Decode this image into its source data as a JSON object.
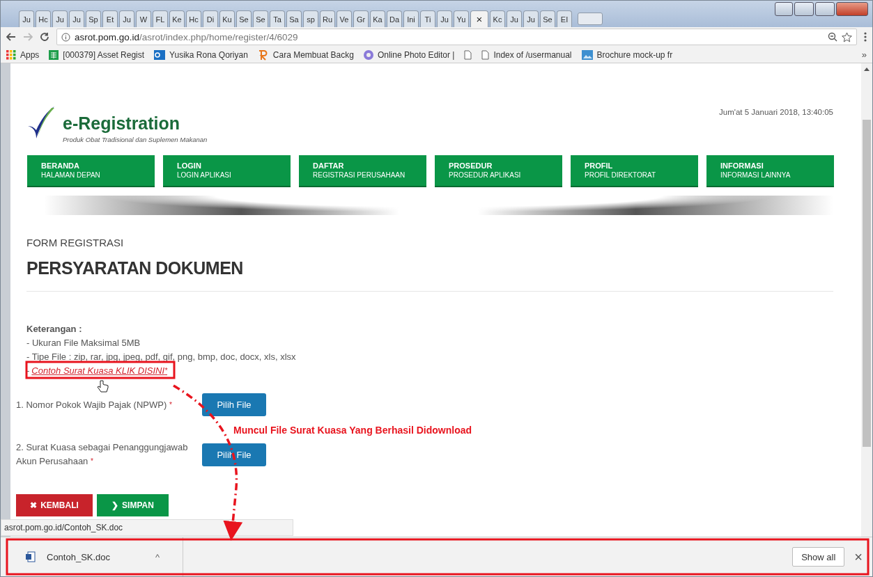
{
  "browser": {
    "tabs": [
      {
        "label": "Ju",
        "selected": false
      },
      {
        "label": "Hc",
        "selected": false
      },
      {
        "label": "Ju",
        "selected": false
      },
      {
        "label": "Ju",
        "selected": false
      },
      {
        "label": "Sp",
        "selected": false
      },
      {
        "label": "Et",
        "selected": false
      },
      {
        "label": "Ju",
        "selected": false
      },
      {
        "label": "W",
        "selected": false
      },
      {
        "label": "FL",
        "selected": false
      },
      {
        "label": "Ke",
        "selected": false
      },
      {
        "label": "Hc",
        "selected": false
      },
      {
        "label": "Di",
        "selected": false
      },
      {
        "label": "Ku",
        "selected": false
      },
      {
        "label": "Se",
        "selected": false
      },
      {
        "label": "Se",
        "selected": false
      },
      {
        "label": "Ta",
        "selected": false
      },
      {
        "label": "Sa",
        "selected": false
      },
      {
        "label": "sp",
        "selected": false
      },
      {
        "label": "Ru",
        "selected": false
      },
      {
        "label": "Ve",
        "selected": false
      },
      {
        "label": "Gr",
        "selected": false
      },
      {
        "label": "Ka",
        "selected": false
      },
      {
        "label": "Da",
        "selected": false
      },
      {
        "label": "Ini",
        "selected": false
      },
      {
        "label": "Ti",
        "selected": false
      },
      {
        "label": "Ju",
        "selected": false
      },
      {
        "label": "Yu",
        "selected": false
      },
      {
        "label": "×",
        "selected": true
      },
      {
        "label": "Kc",
        "selected": false
      },
      {
        "label": "Ju",
        "selected": false
      },
      {
        "label": "Ju",
        "selected": false
      },
      {
        "label": "Se",
        "selected": false
      },
      {
        "label": "EI",
        "selected": false
      }
    ],
    "url_host": "asrot.pom.go.id",
    "url_path": "/asrot/index.php/home/register/4/6029",
    "bookmarks": [
      {
        "label": "Apps",
        "kind": "apps"
      },
      {
        "label": "[000379] Asset Regist",
        "kind": "sheet"
      },
      {
        "label": "Yusika Rona Qoriyan",
        "kind": "outlook"
      },
      {
        "label": "Cara Membuat Backg",
        "kind": "r"
      },
      {
        "label": "Online Photo Editor |",
        "kind": "photo"
      },
      {
        "kind": "page"
      },
      {
        "label": "Index of /usermanual",
        "kind": "page"
      },
      {
        "label": "Brochure mock-up fr",
        "kind": "image"
      }
    ],
    "bookmarks_more": "»",
    "status_url": "asrot.pom.go.id/Contoh_SK.doc"
  },
  "site": {
    "title": "e-Registration",
    "subtitle": "Produk Obat Tradisional dan Suplemen Makanan",
    "datetime": "Jum'at 5 Januari 2018, 13:40:05",
    "nav": [
      {
        "title": "BERANDA",
        "subtitle": "HALAMAN DEPAN"
      },
      {
        "title": "LOGIN",
        "subtitle": "LOGIN APLIKASI"
      },
      {
        "title": "DAFTAR",
        "subtitle": "REGISTRASI PERUSAHAAN"
      },
      {
        "title": "PROSEDUR",
        "subtitle": "PROSEDUR APLIKASI"
      },
      {
        "title": "PROFIL",
        "subtitle": "PROFIL DIREKTORAT"
      },
      {
        "title": "INFORMASI",
        "subtitle": "INFORMASI LAINNYA"
      }
    ]
  },
  "form": {
    "breadcrumb": "FORM REGISTRASI",
    "heading": "PERSYARATAN DOKUMEN",
    "notes_title": "Keterangan :",
    "notes": [
      "- Ukuran File Maksimal 5MB",
      "- Tipe File : zip, rar, jpg, jpeg, pdf, gif, png, bmp, doc, docx, xls, xlsx"
    ],
    "link_prefix": "-",
    "link": "Contoh Surat Kuasa KLIK DISINI",
    "link_mark": "*",
    "fields": [
      {
        "label": "1. Nomor Pokok Wajib Pajak (NPWP)",
        "required": "*",
        "button": "Pilih File"
      },
      {
        "label": "2. Surat Kuasa sebagai Penanggungjawab Akun Perusahaan",
        "required": "*",
        "button": "Pilih File"
      }
    ],
    "back_icon": "✖",
    "back": "KEMBALI",
    "save_icon": "❯",
    "save": "SIMPAN"
  },
  "downloads": {
    "file": "Contoh_SK.doc",
    "caret": "^",
    "show_all": "Show all",
    "close": "×"
  },
  "annotation": {
    "text": "Muncul File Surat Kuasa Yang Berhasil Didownload"
  }
}
